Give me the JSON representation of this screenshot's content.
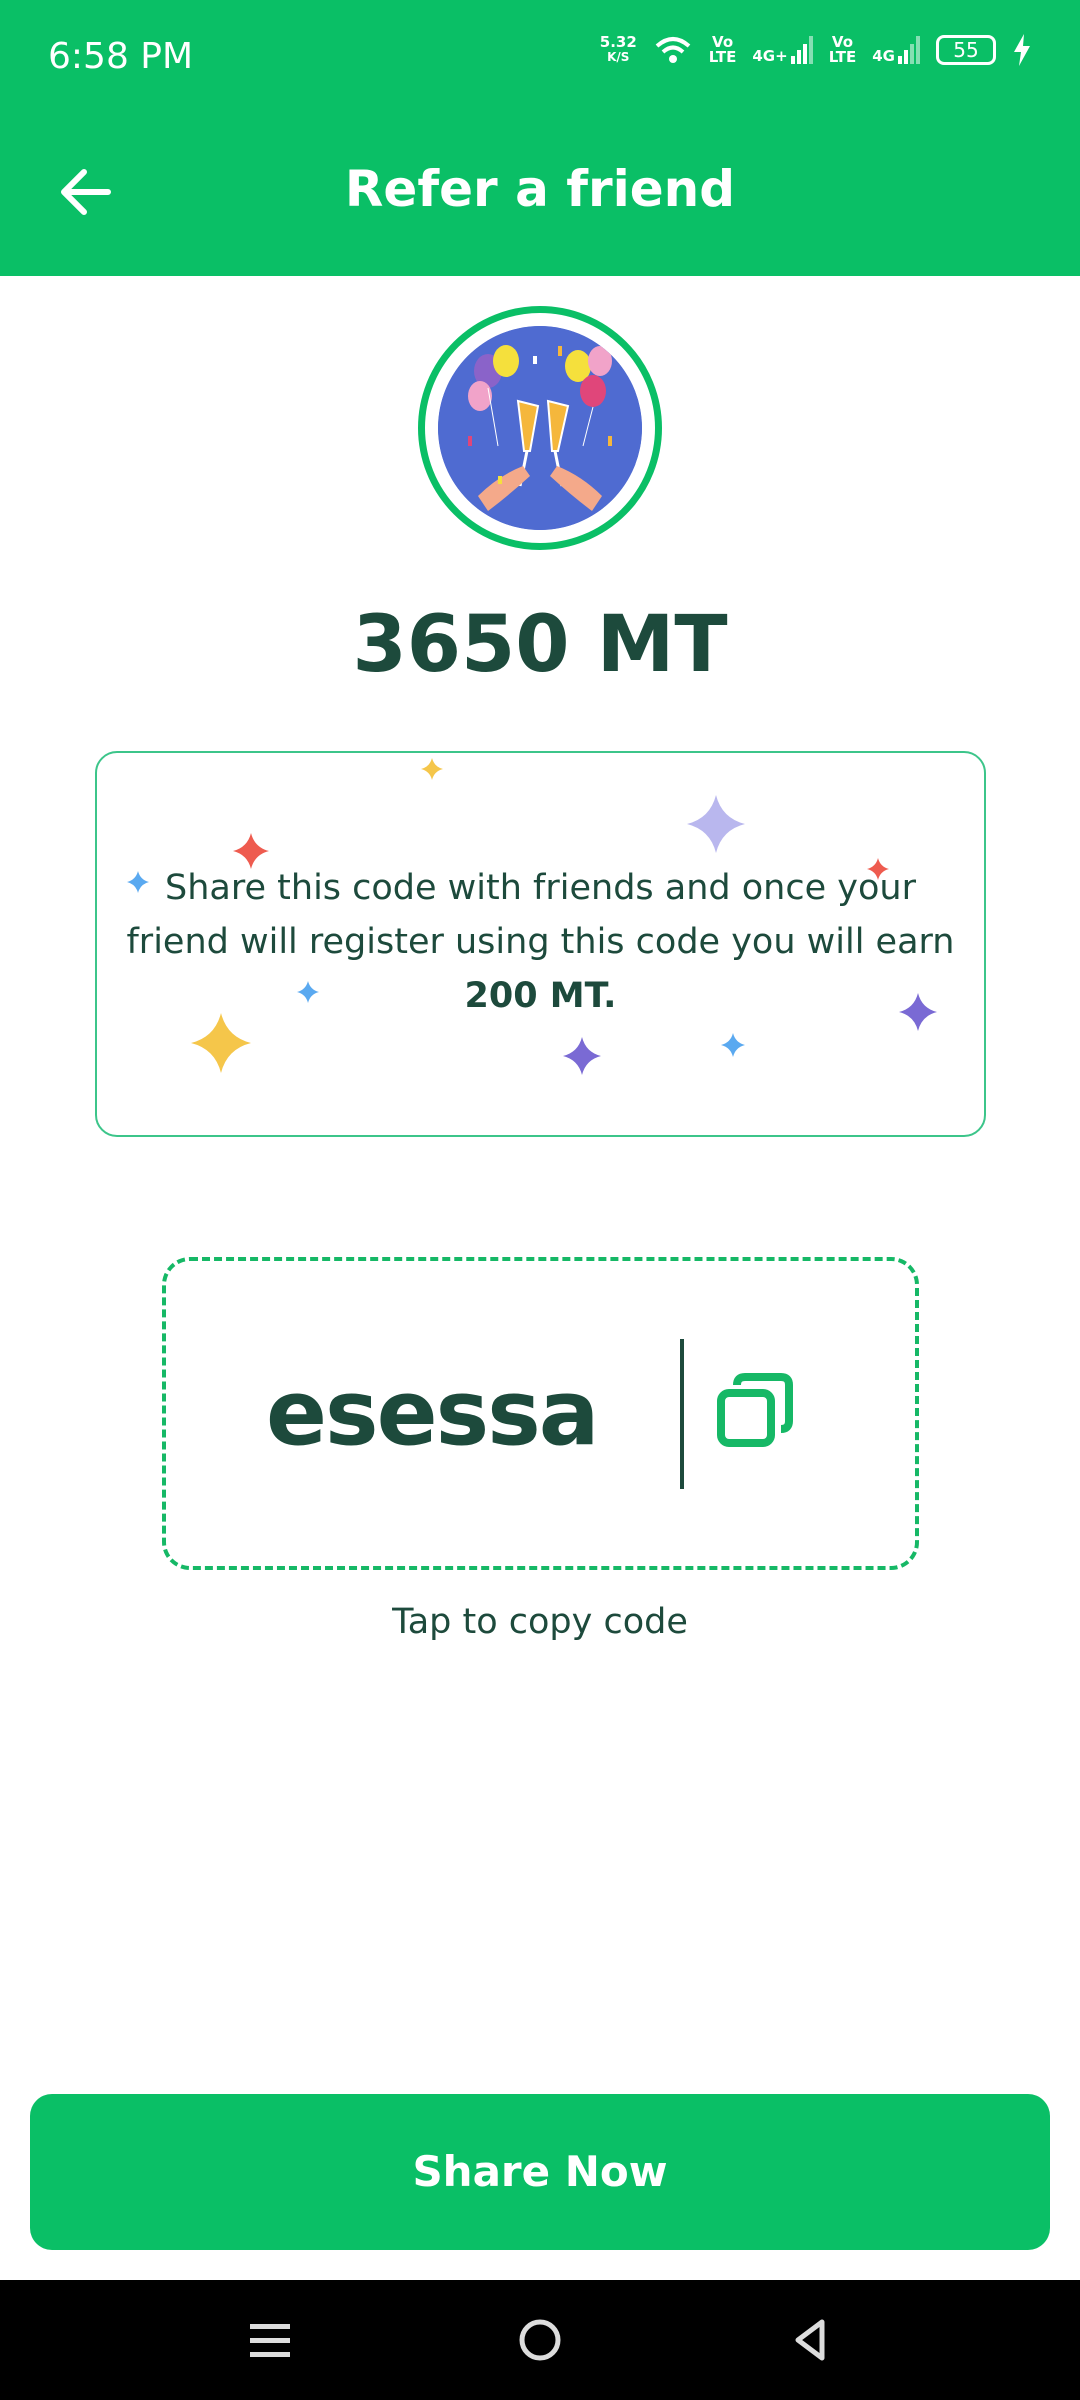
{
  "status_bar": {
    "time": "6:58 PM",
    "speed_value": "5.32",
    "speed_unit": "K/S",
    "volte_1": "Vo",
    "volte_1b": "LTE",
    "net_1": "4G+",
    "volte_2": "Vo",
    "volte_2b": "LTE",
    "net_2": "4G",
    "battery": "55"
  },
  "header": {
    "title": "Refer a friend"
  },
  "balance": {
    "value": "3650 MT"
  },
  "info_card": {
    "text_before": "Share this code with friends and once your friend will register using this code you will earn ",
    "text_bold": "200 MT."
  },
  "referral": {
    "code": "esessa",
    "copy_hint": "Tap to copy code"
  },
  "actions": {
    "share_label": "Share Now"
  },
  "colors": {
    "primary": "#0abf66",
    "text_dark": "#1d4a3c"
  }
}
